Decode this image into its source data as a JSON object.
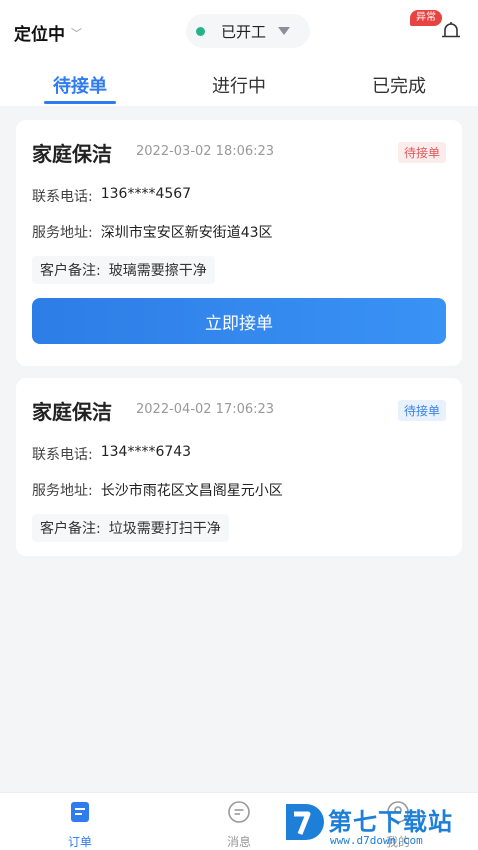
{
  "header": {
    "location": "定位中",
    "work_status": "已开工",
    "alert_badge": "异常"
  },
  "tabs": [
    {
      "label": "待接单",
      "active": true
    },
    {
      "label": "进行中",
      "active": false
    },
    {
      "label": "已完成",
      "active": false
    }
  ],
  "orders": [
    {
      "title": "家庭保洁",
      "time": "2022-03-02 18:06:23",
      "status": "待接单",
      "phone_label": "联系电话:",
      "phone": "136****4567",
      "address_label": "服务地址:",
      "address": "深圳市宝安区新安街道43区",
      "note_label": "客户备注:",
      "note": "玻璃需要擦干净",
      "action": "立即接单"
    },
    {
      "title": "家庭保洁",
      "time": "2022-04-02 17:06:23",
      "status": "待接单",
      "phone_label": "联系电话:",
      "phone": "134****6743",
      "address_label": "服务地址:",
      "address": "长沙市雨花区文昌阁星元小区",
      "note_label": "客户备注:",
      "note": "垃圾需要打扫干净"
    }
  ],
  "bottom_nav": [
    {
      "label": "订单",
      "icon": "order-icon",
      "active": true
    },
    {
      "label": "消息",
      "icon": "message-icon",
      "active": false
    },
    {
      "label": "我的",
      "icon": "profile-icon",
      "active": false
    }
  ],
  "watermark": {
    "name": "第七下载站",
    "url": "www.d7down.com"
  },
  "colors": {
    "accent": "#2f7bf0",
    "status_online": "#25b38a",
    "alert": "#e84343"
  }
}
